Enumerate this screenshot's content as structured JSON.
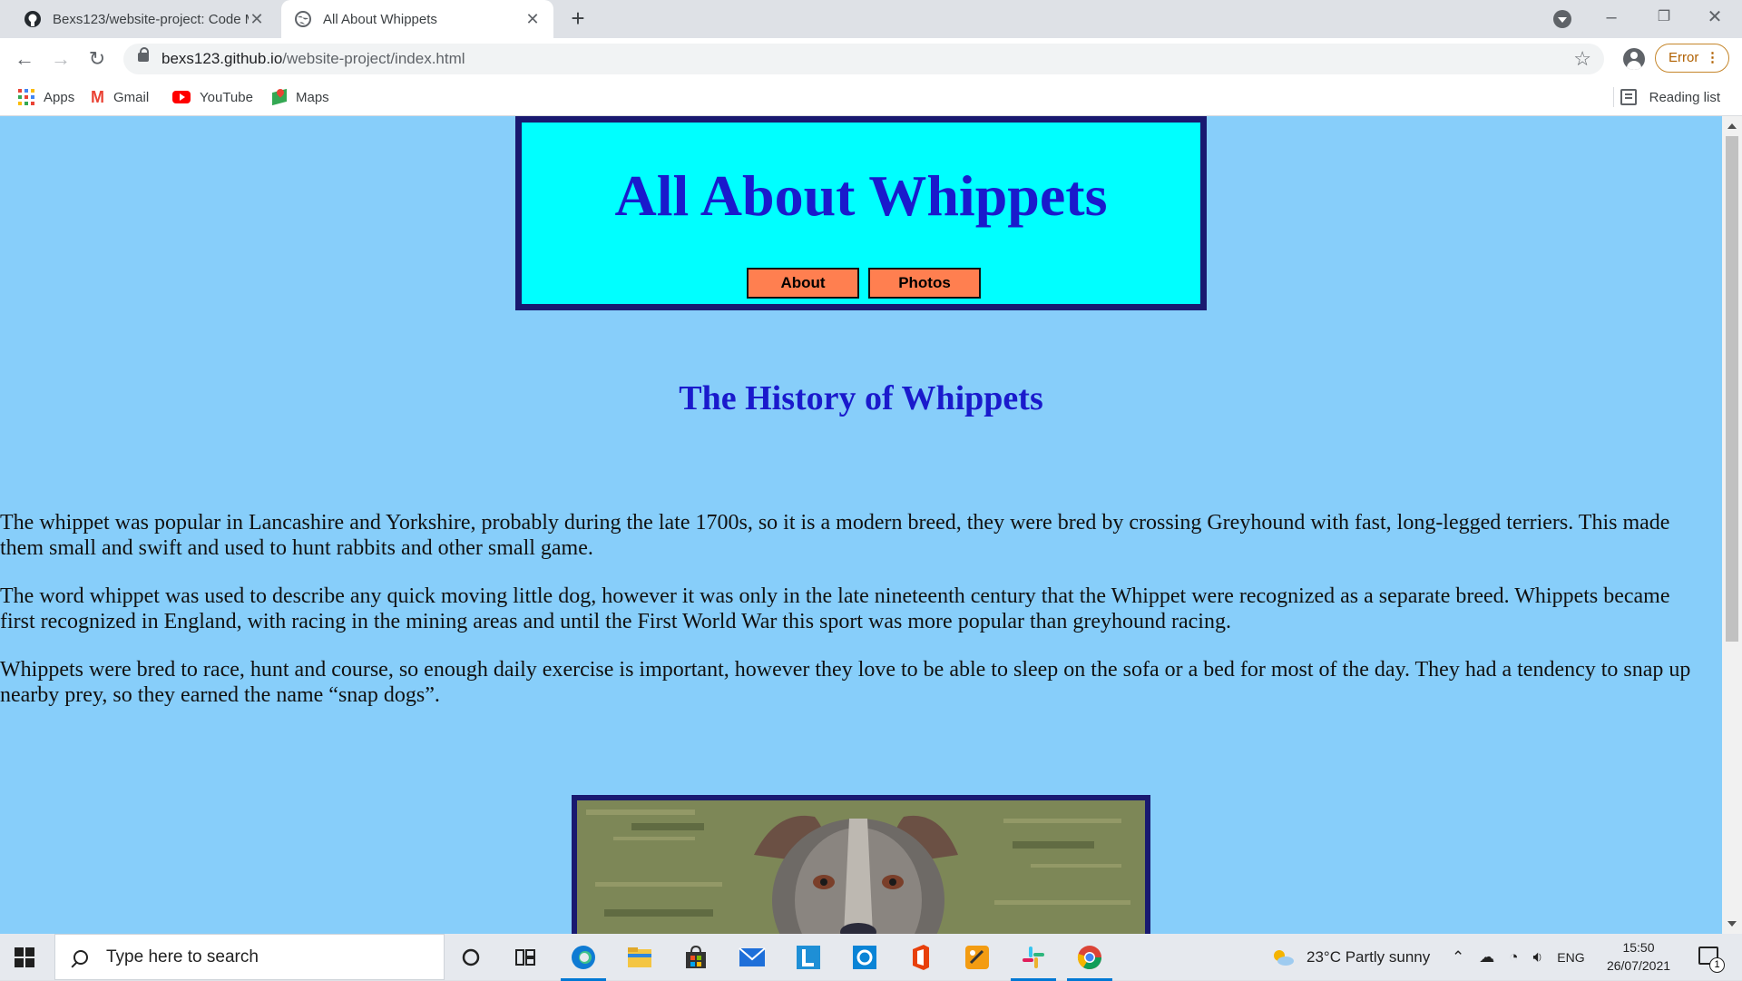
{
  "browser": {
    "tabs": [
      {
        "title": "Bexs123/website-project: Code M",
        "close": "✕"
      },
      {
        "title": "All About Whippets",
        "close": "✕"
      }
    ],
    "new_tab": "+",
    "window_controls": {
      "minimize": "–",
      "restore": "❐",
      "close": "✕"
    },
    "url_domain": "bexs123.github.io",
    "url_path": "/website-project/index.html",
    "bookmark_star": "☆",
    "error_label": "Error",
    "error_menu": "⋮",
    "bookmarks": [
      {
        "label": "Apps",
        "icon": "apps-grid-icon"
      },
      {
        "label": "Gmail",
        "icon": "gmail-icon"
      },
      {
        "label": "YouTube",
        "icon": "youtube-icon"
      },
      {
        "label": "Maps",
        "icon": "maps-icon"
      }
    ],
    "gmail_glyph": "M",
    "reading_list": "Reading list"
  },
  "page": {
    "site_title": "All About Whippets",
    "nav": [
      {
        "label": "About"
      },
      {
        "label": "Photos"
      }
    ],
    "section_heading": "The History of Whippets",
    "paragraphs": [
      "The whippet was popular in Lancashire and Yorkshire, probably during the late 1700s, so it is a modern breed, they were bred by crossing Greyhound with fast, long-legged terriers. This made them small and swift and used to hunt rabbits and other small game.",
      "The word whippet was used to describe any quick moving little dog, however it was only in the late nineteenth century that the Whippet were recognized as a separate breed. Whippets became first recognized in England, with racing in the mining areas and until the First World War this sport was more popular than greyhound racing.",
      "Whippets were bred to race, hunt and course, so enough daily exercise is important, however they love to be able to sleep on the sofa or a bed for most of the day. They had a tendency to snap up nearby prey, so they earned the name “snap dogs”."
    ]
  },
  "taskbar": {
    "search_placeholder": "Type here to search",
    "weather": "23°C  Partly sunny",
    "language": "ENG",
    "time": "15:50",
    "date": "26/07/2021",
    "notification_count": "1"
  },
  "colors": {
    "page_bg": "#87cefa",
    "banner_bg": "#00ffff",
    "banner_border": "#191970",
    "heading_text": "#1a1acc",
    "nav_button": "#ff7f50"
  }
}
